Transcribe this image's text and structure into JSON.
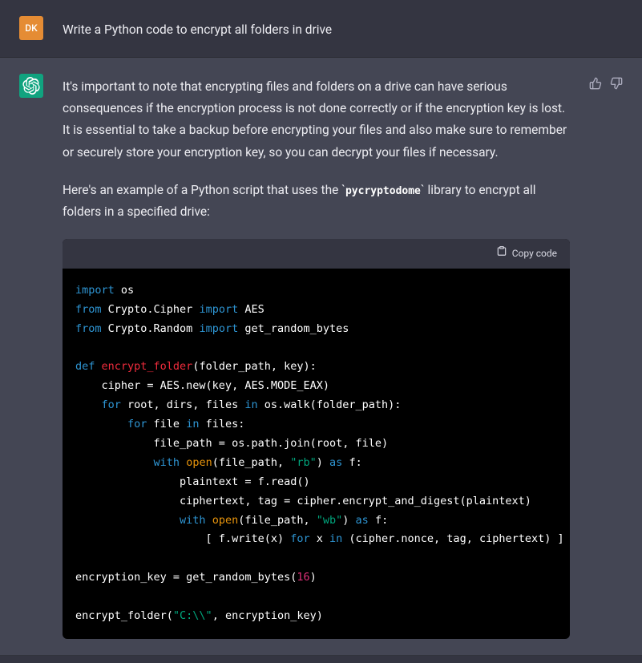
{
  "user": {
    "avatar_text": "DK",
    "prompt": "Write a Python code to encrypt all folders in drive"
  },
  "assistant": {
    "para1": "It's important to note that encrypting files and folders on a drive can have serious consequences if the encryption process is not done correctly or if the encryption key is lost. It is essential to take a backup before encrypting your files and also make sure to remember or securely store your encryption key, so you can decrypt your files if necessary.",
    "para2_pre": "Here's an example of a Python script that uses the `",
    "para2_lib": "pycryptodome",
    "para2_post": "` library to encrypt all folders in a specified drive:"
  },
  "code": {
    "copy_label": "Copy code",
    "l1_kw": "import",
    "l1_mod": " os",
    "l2_kw1": "from",
    "l2_mod1": " Crypto.Cipher ",
    "l2_kw2": "import",
    "l2_mod2": " AES",
    "l3_kw1": "from",
    "l3_mod1": " Crypto.Random ",
    "l3_kw2": "import",
    "l3_mod2": " get_random_bytes",
    "l5_kw": "def",
    "l5_fn": " encrypt_folder",
    "l5_sig": "(folder_path, key):",
    "l6": "    cipher = AES.new(key, AES.MODE_EAX)",
    "l7_pre": "    ",
    "l7_kw1": "for",
    "l7_mid": " root, dirs, files ",
    "l7_kw2": "in",
    "l7_post": " os.walk(folder_path):",
    "l8_pre": "        ",
    "l8_kw1": "for",
    "l8_mid": " file ",
    "l8_kw2": "in",
    "l8_post": " files:",
    "l9": "            file_path = os.path.join(root, file)",
    "l10_pre": "            ",
    "l10_kw": "with",
    "l10_mid1": " ",
    "l10_open": "open",
    "l10_mid2": "(file_path, ",
    "l10_str": "\"rb\"",
    "l10_mid3": ") ",
    "l10_as": "as",
    "l10_post": " f:",
    "l11": "                plaintext = f.read()",
    "l12": "                ciphertext, tag = cipher.encrypt_and_digest(plaintext)",
    "l13_pre": "                ",
    "l13_kw": "with",
    "l13_mid1": " ",
    "l13_open": "open",
    "l13_mid2": "(file_path, ",
    "l13_str": "\"wb\"",
    "l13_mid3": ") ",
    "l13_as": "as",
    "l13_post": " f:",
    "l14_pre": "                    [ f.write(x) ",
    "l14_kw1": "for",
    "l14_mid": " x ",
    "l14_kw2": "in",
    "l14_post": " (cipher.nonce, tag, ciphertext) ]",
    "l16_pre": "encryption_key = get_random_bytes(",
    "l16_num": "16",
    "l16_post": ")",
    "l18_pre": "encrypt_folder(",
    "l18_str": "\"C:\\\\\"",
    "l18_post": ", encryption_key)"
  }
}
